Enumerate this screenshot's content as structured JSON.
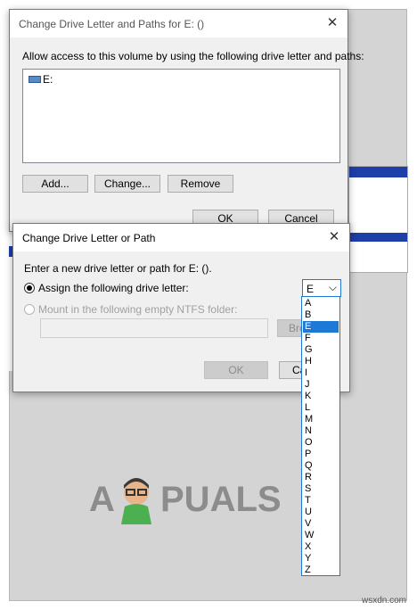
{
  "dialog1": {
    "title": "Change Drive Letter and Paths for E: ()",
    "close_icon": "✕",
    "description": "Allow access to this volume by using the following drive letter and paths:",
    "list_item": "E:",
    "buttons": {
      "add": "Add...",
      "change": "Change...",
      "remove": "Remove",
      "ok": "OK",
      "cancel": "Cancel"
    }
  },
  "dialog2": {
    "title": "Change Drive Letter or Path",
    "close_icon": "✕",
    "prompt": "Enter a new drive letter or path for E: ().",
    "option_assign": "Assign the following drive letter:",
    "option_mount": "Mount in the following empty NTFS folder:",
    "browse_partial": "Bro",
    "ok": "OK",
    "cancel_partial": "Ca",
    "selected_letter": "E",
    "chevron": "⌵"
  },
  "dropdown": {
    "letters": [
      "A",
      "B",
      "E",
      "F",
      "G",
      "H",
      "I",
      "J",
      "K",
      "L",
      "M",
      "N",
      "O",
      "P",
      "Q",
      "R",
      "S",
      "T",
      "U",
      "V",
      "W",
      "X",
      "Y",
      "Z"
    ]
  },
  "watermark": {
    "left": "A",
    "right": "PUALS"
  },
  "footer": {
    "site": "wsxdn.com"
  }
}
